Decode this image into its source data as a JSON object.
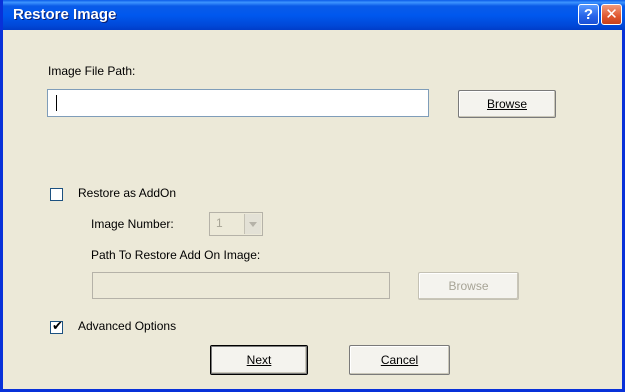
{
  "window": {
    "title": "Restore Image",
    "help_glyph": "?",
    "close_glyph": "✕"
  },
  "image_path": {
    "label": "Image File Path:",
    "value": "",
    "browse_label": "Browse"
  },
  "restore_addon": {
    "checkbox_label": "Restore as AddOn",
    "checked": false,
    "image_number_label": "Image Number:",
    "image_number_value": "1",
    "path_label": "Path To Restore Add On Image:",
    "path_value": "",
    "browse_label": "Browse"
  },
  "advanced": {
    "checkbox_label": "Advanced Options",
    "checked": true,
    "check_glyph": "✔"
  },
  "footer": {
    "next_label": "Next",
    "cancel_label": "Cancel"
  },
  "colors": {
    "titlebar": "#0058EE",
    "dialog_bg": "#ECE9D8"
  }
}
